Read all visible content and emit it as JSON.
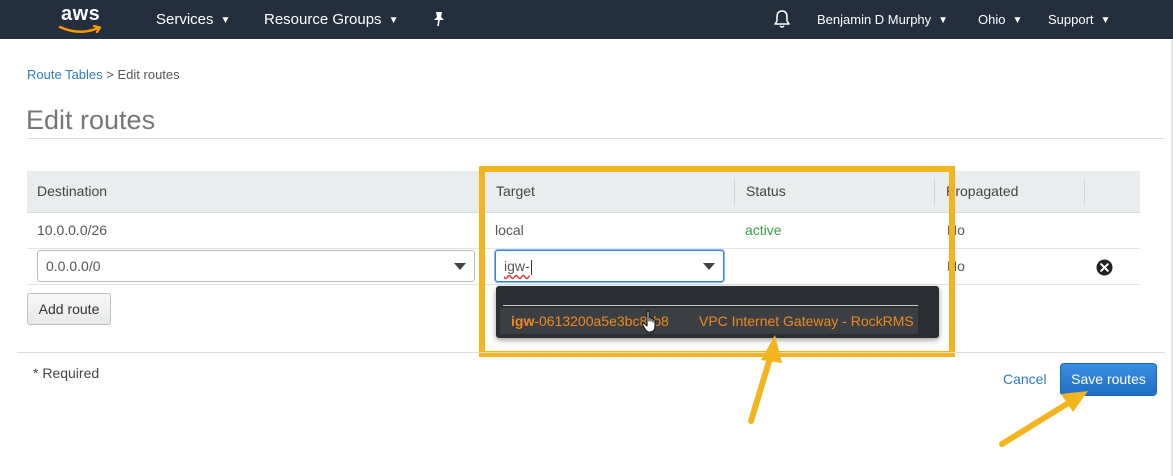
{
  "nav": {
    "logo": "aws",
    "services": "Services",
    "resource_groups": "Resource Groups",
    "user": "Benjamin D Murphy",
    "region": "Ohio",
    "support": "Support"
  },
  "breadcrumb": {
    "parent": "Route Tables",
    "separator": ">",
    "current": "Edit routes"
  },
  "page_title": "Edit routes",
  "table": {
    "headers": {
      "destination": "Destination",
      "target": "Target",
      "status": "Status",
      "propagated": "Propagated"
    },
    "rows": [
      {
        "destination": "10.0.0.0/26",
        "target": "local",
        "status": "active",
        "propagated": "No"
      },
      {
        "destination": "0.0.0.0/0",
        "target_input": "igw-",
        "status": "",
        "propagated": "No"
      }
    ]
  },
  "add_route_label": "Add route",
  "dropdown": {
    "option_id_prefix": "igw",
    "option_id_rest": "-0613200a5e3bc8",
    "option_id_tail": "b8",
    "option_desc": "VPC Internet Gateway - RockRMS"
  },
  "footer": {
    "required": "* Required",
    "cancel": "Cancel",
    "save": "Save routes"
  },
  "colors": {
    "nav_bg": "#232f3e",
    "link": "#2f7bbf",
    "status_active": "#3b9c46",
    "highlight": "#f3b51d",
    "primary_button": "#1f6fc5",
    "dropdown_text": "#f18a1c"
  }
}
